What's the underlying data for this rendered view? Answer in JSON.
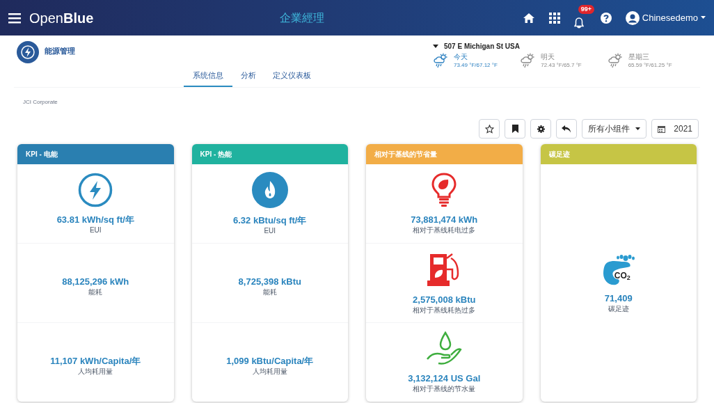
{
  "header": {
    "logo": "Open**Blue**",
    "title": "企業經理",
    "notification_count": "99+",
    "user": "Chinesedemo"
  },
  "app": {
    "title": "能源管理"
  },
  "tabs": [
    {
      "label": "系统信息",
      "selected": true
    },
    {
      "label": "分析",
      "selected": false
    },
    {
      "label": "定义仪表板",
      "selected": false
    }
  ],
  "weather": {
    "location": "507 E Michigan St USA",
    "days": [
      {
        "label": "今天",
        "temps": "73.49 °F/67.12 °F",
        "selected": true
      },
      {
        "label": "明天",
        "temps": "72.43 °F/65.7 °F",
        "selected": false
      },
      {
        "label": "星期三",
        "temps": "65.59 °F/61.25 °F",
        "selected": false
      }
    ]
  },
  "breadcrumb": "JCI Corporate",
  "toolbar": {
    "widgets_dropdown": "所有小组件",
    "year": "2021"
  },
  "cards": [
    {
      "title": "KPI - 电能",
      "color": "#2a7fb0",
      "metrics": [
        {
          "kind": "bolt",
          "value": "63.81 kWh/sq ft/年",
          "label": "EUI"
        },
        {
          "kind": "plain",
          "value": "88,125,296 kWh",
          "label": "能耗"
        },
        {
          "kind": "plain",
          "value": "11,107 kWh/Capita/年",
          "label": "人均耗用量"
        }
      ]
    },
    {
      "title": "KPI - 热能",
      "color": "#20b29f",
      "metrics": [
        {
          "kind": "flame",
          "value": "6.32 kBtu/sq ft/年",
          "label": "EUI"
        },
        {
          "kind": "plain",
          "value": "8,725,398 kBtu",
          "label": "能耗"
        },
        {
          "kind": "plain",
          "value": "1,099 kBtu/Capita/年",
          "label": "人均耗用量"
        }
      ]
    },
    {
      "title": "相对于基线的节省量",
      "color": "#f2ad47",
      "metrics": [
        {
          "kind": "bulb",
          "value": "73,881,474 kWh",
          "label": "相对于基线耗电过多"
        },
        {
          "kind": "pump",
          "value": "2,575,008 kBtu",
          "label": "相对于基线耗热过多"
        },
        {
          "kind": "water",
          "value": "3,132,124 US Gal",
          "label": "相对于基线的节水量"
        }
      ]
    },
    {
      "title": "碳足迹",
      "color": "#c6c545",
      "metrics": [
        {
          "kind": "footprint",
          "icon_text": "CO$_{2}$",
          "value": "71,409",
          "label": "碳足迹"
        }
      ]
    }
  ]
}
